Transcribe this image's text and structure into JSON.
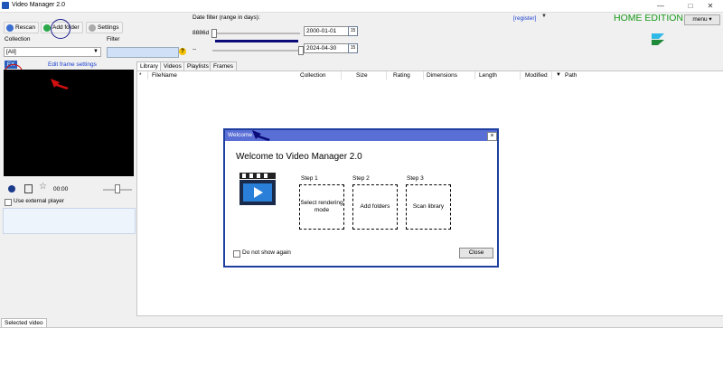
{
  "window": {
    "title": "Video Manager 2.0",
    "minimize": "—",
    "maximize": "□",
    "close": "✕"
  },
  "toolbar": {
    "rescan": "Rescan",
    "add_folder": "Add folder",
    "settings": "Settings"
  },
  "collection": {
    "label": "Collection",
    "value": "[All]"
  },
  "filter": {
    "label": "Filter",
    "help": "?"
  },
  "date_filter": {
    "label": "Date filter (range in days):",
    "days": "8886d",
    "from": "2000-01-01",
    "to": "2024-04-30",
    "dash": "--"
  },
  "register": "[register]",
  "edition": "HOME EDITION",
  "menu": "menu",
  "preview": {
    "fx": "FX",
    "edit_frame": "Edit frame settings",
    "time": "00:00",
    "external_player": "Use external player"
  },
  "tabs": [
    "Library",
    "Videos",
    "Playlists",
    "Frames"
  ],
  "columns": [
    "*",
    "FileName",
    "Collection",
    "Size",
    "Rating",
    "Dimensions",
    "Length",
    "Modified",
    "Path"
  ],
  "sort_indicator": "▼",
  "bottom_tab": "Selected video",
  "dialog": {
    "title": "Welcome",
    "heading": "Welcome to Video Manager 2.0",
    "steps": [
      {
        "label": "Step 1",
        "text": "Select rendering mode"
      },
      {
        "label": "Step 2",
        "text": "Add folders"
      },
      {
        "label": "Step 3",
        "text": "Scan library"
      }
    ],
    "dont_show": "Do not show again",
    "close_button": "Close",
    "close_x": "×"
  },
  "colors": {
    "accent": "#1f3fa0",
    "edition": "#1a9a1a",
    "dialog_title": "#5a6fd6"
  }
}
